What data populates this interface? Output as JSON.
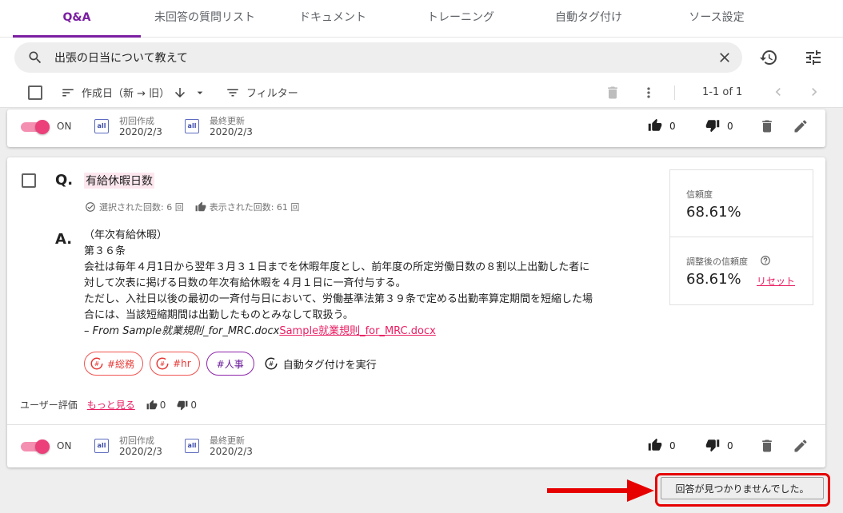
{
  "tabs": [
    {
      "label": "Q&A"
    },
    {
      "label": "未回答の質問リスト"
    },
    {
      "label": "ドキュメント"
    },
    {
      "label": "トレーニング"
    },
    {
      "label": "自動タグ付け"
    },
    {
      "label": "ソース設定"
    }
  ],
  "search": {
    "value": "出張の日当について教えて"
  },
  "toolbar": {
    "sort_label": "作成日（新 → 旧）",
    "filter_label": "フィルター",
    "pagination": "1-1 of 1"
  },
  "top_row": {
    "toggle_label": "ON",
    "created_label": "初回作成",
    "created_date": "2020/2/3",
    "updated_label": "最終更新",
    "updated_date": "2020/2/3",
    "icon_text": "all",
    "likes": "0",
    "dislikes": "0"
  },
  "qa": {
    "q_mark": "Q.",
    "title": "有給休暇日数",
    "selected_count": "選択された回数: 6 回",
    "displayed_count": "表示された回数: 61 回",
    "a_mark": "A.",
    "answer_lines": [
      "（年次有給休暇）",
      "第３６条",
      "会社は毎年４月1日から翌年３月３１日までを休暇年度とし、前年度の所定労働日数の８割以上出勤した者に",
      "対して次表に掲げる日数の年次有給休暇を４月１日に一斉付与する。",
      "ただし、入社日以後の最初の一斉付与日において、労働基準法第３９条で定める出勤率算定期間を短縮した場",
      "合には、当該短縮期間は出勤したものとみなして取扱う。"
    ],
    "source_prefix": "– From Sample就業規則_for_MRC.docx",
    "source_link": "Sample就業規則_for_MRC.docx",
    "tags": [
      "#総務",
      "#hr",
      "#人事"
    ],
    "autotag_label": "自動タグ付けを実行",
    "rating_label": "ユーザー評価",
    "rating_more": "もっと見る",
    "rating_likes": "0",
    "rating_dislikes": "0",
    "confidence_label": "信頼度",
    "confidence_value": "68.61%",
    "adj_confidence_label": "調整後の信頼度",
    "adj_confidence_value": "68.61%",
    "reset_label": "リセット"
  },
  "bottom_row": {
    "toggle_label": "ON",
    "created_label": "初回作成",
    "created_date": "2020/2/3",
    "updated_label": "最終更新",
    "updated_date": "2020/2/3",
    "icon_text": "all",
    "likes": "0",
    "dislikes": "0"
  },
  "not_found_button": "回答が見つかりませんでした。",
  "colors": {
    "accent": "#7b1fa2",
    "pink": "#e91e63",
    "highlight": "#e60000"
  }
}
